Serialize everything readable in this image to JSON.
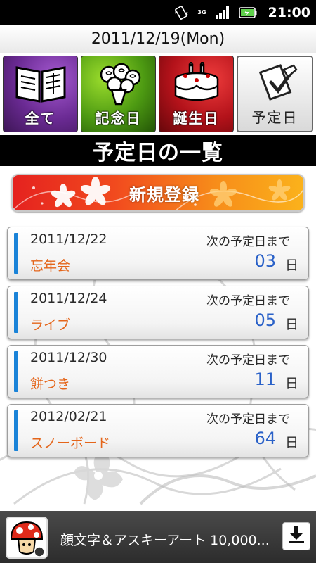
{
  "status_bar": {
    "time": "21:00",
    "network": "3G",
    "icons": [
      "vibrate-icon",
      "network-3g-icon",
      "signal-icon",
      "battery-icon"
    ]
  },
  "header": {
    "date": "2011/12/19(Mon)"
  },
  "tiles": [
    {
      "label": "全て",
      "icon": "book-icon",
      "color": "#6a2a93"
    },
    {
      "label": "記念日",
      "icon": "bouquet-icon",
      "color": "#4d9a12"
    },
    {
      "label": "誕生日",
      "icon": "cake-icon",
      "color": "#b3121a"
    },
    {
      "label": "予定日",
      "icon": "calendar-pen-icon",
      "color": "#e6e6e6"
    }
  ],
  "section": {
    "title": "予定日の一覧"
  },
  "new_button": {
    "label": "新規登録"
  },
  "events": [
    {
      "date": "2011/12/22",
      "name": "忘年会",
      "until_label": "次の予定日まで",
      "days": "03",
      "unit": "日"
    },
    {
      "date": "2011/12/24",
      "name": "ライブ",
      "until_label": "次の予定日まで",
      "days": "05",
      "unit": "日"
    },
    {
      "date": "2011/12/30",
      "name": "餅つき",
      "until_label": "次の予定日まで",
      "days": "11",
      "unit": "日"
    },
    {
      "date": "2012/02/21",
      "name": "スノーボード",
      "until_label": "次の予定日まで",
      "days": "64",
      "unit": "日"
    }
  ],
  "ad": {
    "text": "顔文字＆アスキーアート 10,000...",
    "icon": "download-icon"
  },
  "colors": {
    "accent_bar": "#1a83d8",
    "event_name": "#e4651a",
    "days_number": "#2a61c8",
    "new_button_start": "#e5221f",
    "new_button_end": "#fbb21b"
  }
}
